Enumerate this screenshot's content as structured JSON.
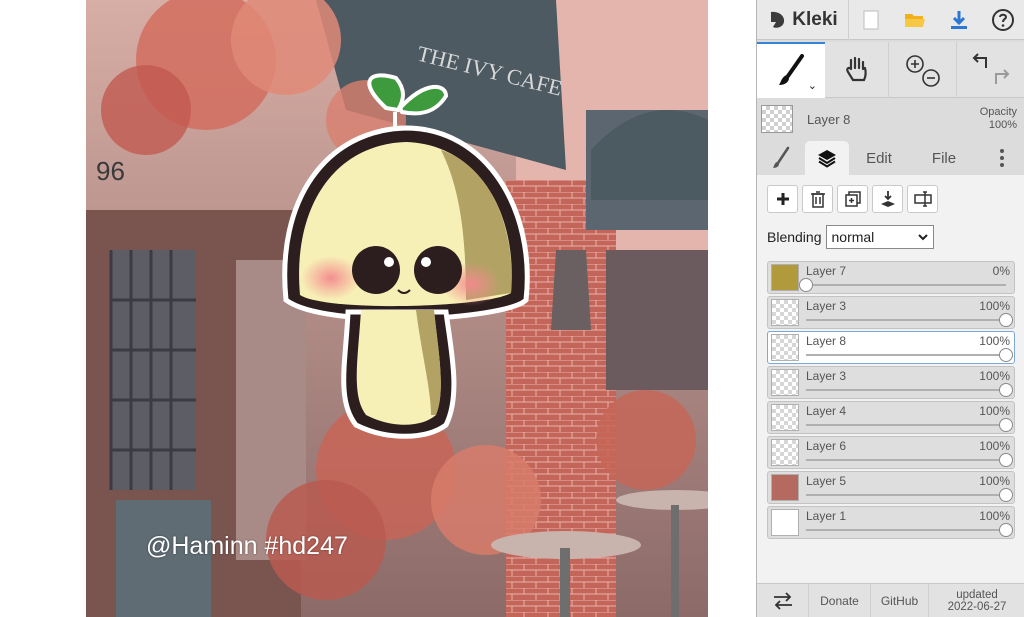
{
  "canvas": {
    "watermark": "@Haminn #hd247",
    "storefront_sign": "THE IVY CAFE",
    "house_number": "96"
  },
  "app": {
    "logo_text": "Kleki",
    "accent_color": "#3a84d8"
  },
  "topbar": {
    "icons": [
      "new-image-icon",
      "open-folder-icon",
      "download-icon",
      "help-icon"
    ]
  },
  "current_layer": {
    "name": "Layer 8",
    "opacity_label": "Opacity",
    "opacity_value": "100%"
  },
  "tabs": {
    "edit": "Edit",
    "file": "File"
  },
  "layer_panel": {
    "blending_label": "Blending",
    "blending_value": "normal",
    "layers": [
      {
        "name": "Layer 7",
        "opacity": "0%",
        "level": 0,
        "thumb": "#b09a3c",
        "selected": false
      },
      {
        "name": "Layer 3",
        "opacity": "100%",
        "level": 1,
        "thumb": "",
        "selected": false
      },
      {
        "name": "Layer 8",
        "opacity": "100%",
        "level": 1,
        "thumb": "",
        "selected": true
      },
      {
        "name": "Layer 3",
        "opacity": "100%",
        "level": 1,
        "thumb": "",
        "selected": false
      },
      {
        "name": "Layer 4",
        "opacity": "100%",
        "level": 1,
        "thumb": "",
        "selected": false
      },
      {
        "name": "Layer 6",
        "opacity": "100%",
        "level": 1,
        "thumb": "",
        "selected": false
      },
      {
        "name": "Layer 5",
        "opacity": "100%",
        "level": 1,
        "thumb": "#b56a60",
        "selected": false
      },
      {
        "name": "Layer 1",
        "opacity": "100%",
        "level": 1,
        "thumb": "#ffffff",
        "selected": false
      }
    ]
  },
  "footer": {
    "donate": "Donate",
    "github": "GitHub",
    "updated_line1": "updated",
    "updated_line2": "2022-06-27"
  }
}
